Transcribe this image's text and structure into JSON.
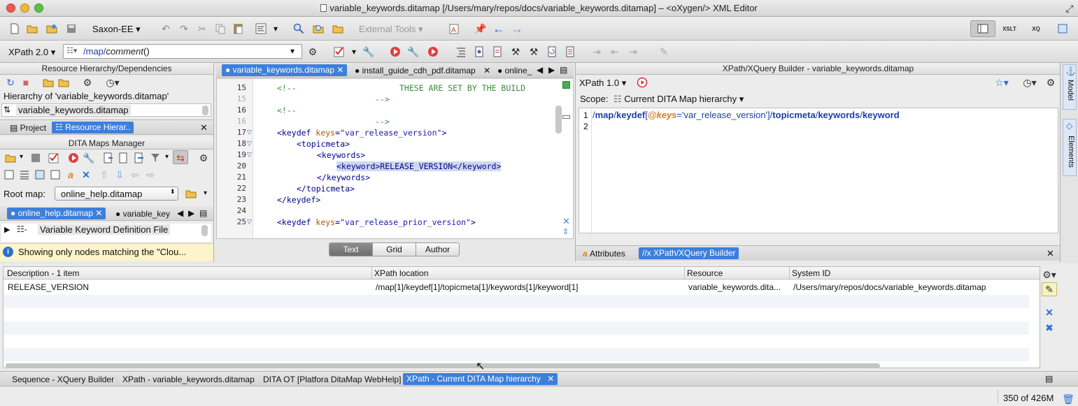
{
  "window": {
    "title": "variable_keywords.ditamap [/Users/mary/repos/docs/variable_keywords.ditamap] – <oXygen/> XML Editor",
    "traffic_light_colors": [
      "#ee5a4f",
      "#f5b63a",
      "#5cc13f"
    ]
  },
  "toolbar1": {
    "transformer": "Saxon-EE",
    "external_tools": "External Tools"
  },
  "toolbar2": {
    "xpath_version": "XPath 2.0",
    "xpath_expr_slash1": "/",
    "xpath_expr_map": "map",
    "xpath_expr_slash2": "/",
    "xpath_expr_comment": "comment",
    "xpath_expr_paren": "()"
  },
  "left": {
    "resource_header": "Resource Hierarchy/Dependencies",
    "hierarchy_of": "Hierarchy of 'variable_keywords.ditamap'",
    "hierarchy_item": "variable_keywords.ditamap",
    "tab_project": "Project",
    "tab_resource": "Resource Hierar..",
    "dita_maps_header": "DITA Maps Manager",
    "root_map_label": "Root map:",
    "root_map_value": "online_help.ditamap",
    "map_tab_1": "online_help.ditamap",
    "map_tab_2": "variable_key",
    "tree_item": "Variable Keyword Definition File",
    "filter_msg": "Showing only nodes matching the \"Clou..."
  },
  "editor": {
    "tabs": [
      "variable_keywords.ditamap",
      "install_guide_cdh_pdf.ditamap",
      "online_"
    ],
    "line_numbers": [
      "15",
      "15",
      "16",
      "16",
      "17",
      "18",
      "19",
      "20",
      "21",
      "22",
      "23",
      "24",
      "25"
    ],
    "comment_open": "<!--",
    "comment_build": "THESE ARE SET BY THE BUILD",
    "comment_close": "-->",
    "keydef_open": "<keydef ",
    "keys_attr": "keys",
    "eq": "=",
    "val_release": "\"var_release_version\"",
    "gt": ">",
    "topicmeta_open": "<topicmeta>",
    "keywords_open": "<keywords>",
    "keyword_line": "<keyword>RELEASE_VERSION</keyword>",
    "keywords_close": "</keywords>",
    "topicmeta_close": "</topicmeta>",
    "keydef_close": "</keydef>",
    "val_prior": "\"var_release_prior_version\"",
    "mode_text": "Text",
    "mode_grid": "Grid",
    "mode_author": "Author"
  },
  "builder": {
    "header": "XPath/XQuery Builder - variable_keywords.ditamap",
    "version": "XPath 1.0",
    "scope_label": "Scope:",
    "scope_value": "Current DITA Map hierarchy",
    "line1": "1",
    "line2": "2",
    "expr_slash": "/",
    "expr_map": "map",
    "expr_keydef": "keydef",
    "expr_bracket_open": "[",
    "expr_attr": "@keys",
    "expr_eq": "=",
    "expr_value": "'var_release_version'",
    "expr_bracket_close": "]",
    "expr_topicmeta": "topicmeta",
    "expr_keywords": "keywords",
    "expr_keyword": "keyword",
    "tab_attributes": "Attributes",
    "tab_builder": "XPath/XQuery Builder",
    "side_model": "Model",
    "side_elements": "Elements"
  },
  "results": {
    "columns": [
      "Description - 1 item",
      "XPath location",
      "Resource",
      "System ID"
    ],
    "rows": [
      {
        "description": "RELEASE_VERSION",
        "xpath": "/map[1]/keydef[1]/topicmeta[1]/keywords[1]/keyword[1]",
        "resource": "variable_keywords.dita...",
        "system_id": "/Users/mary/repos/docs/variable_keywords.ditamap"
      }
    ]
  },
  "bottom_tabs": [
    "Sequence - XQuery Builder",
    "XPath - variable_keywords.ditamap",
    "DITA OT [Platfora DitaMap WebHelp]",
    "XPath - Current DITA Map hierarchy"
  ],
  "status": {
    "memory": "350 of 426M"
  },
  "colors": {
    "selection_blue": "#3d7fdb",
    "tag": "#00008b",
    "attribute": "#b05a00",
    "value": "#1a1ab5",
    "comment": "#3c8c3c",
    "expr_path": "#1a3fa8",
    "expr_attr": "#e07a1a"
  }
}
